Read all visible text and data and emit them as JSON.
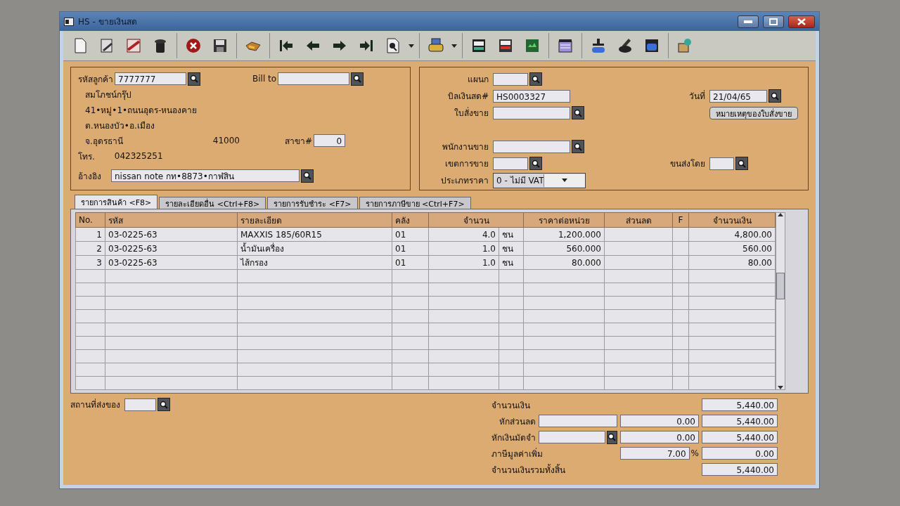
{
  "window": {
    "title": "HS - ขายเงินสด"
  },
  "customer": {
    "code_label": "รหัสลูกค้า",
    "code": "7777777",
    "bill_to_label": "Bill to",
    "name": "สมโภชน์กรุ๊ป",
    "address_lines": [
      "41•หมู่•1•ถนนอุดร-หนองคาย",
      "ต.หนองบัว•อ.เมือง"
    ],
    "province": "จ.อุดรธานี",
    "postcode": "41000",
    "branch_label": "สาขา#",
    "branch": "0",
    "phone_label": "โทร.",
    "phone": "042325251",
    "reference_label": "อ้างอิง",
    "reference": "nissan note กท•8873•กาฬสิน"
  },
  "document": {
    "department_label": "แผนก",
    "bill_label": "บิลเงินสด#",
    "bill_no": "HS0003327",
    "date_label": "วันที่",
    "date": "21/04/65",
    "sales_order_label": "ใบสั่งขาย",
    "note_button": "หมายเหตุของใบสั่งขาย",
    "salesperson_label": "พนักงานขาย",
    "sales_area_label": "เขตการขาย",
    "shipping_label": "ขนส่งโดย",
    "price_type_label": "ประเภทราคา",
    "price_type": "0 - ไม่มี VAT"
  },
  "tabs": [
    {
      "label": "รายการสินค้า <F8>",
      "selected": true
    },
    {
      "label": "รายละเอียดอื่น <Ctrl+F8>",
      "selected": false
    },
    {
      "label": "รายการรับชำระ <F7>",
      "selected": false
    },
    {
      "label": "รายการภาษีขาย <Ctrl+F7>",
      "selected": false
    }
  ],
  "table": {
    "columns": [
      "No.",
      "รหัส",
      "รายละเอียด",
      "คลัง",
      "จำนวน",
      "ราคาต่อหน่วย",
      "ส่วนลด",
      "F",
      "จำนวนเงิน"
    ],
    "rows": [
      {
        "no": "1",
        "code": "03-0225-63",
        "description": "MAXXIS 185/60R15",
        "warehouse": "01",
        "qty": "4.0",
        "unit": "ชน",
        "price": "1,200.000",
        "amount": "4,800.00"
      },
      {
        "no": "2",
        "code": "03-0225-63",
        "description": "น้ำมันเครื่อง",
        "warehouse": "01",
        "qty": "1.0",
        "unit": "ชน",
        "price": "560.000",
        "amount": "560.00"
      },
      {
        "no": "3",
        "code": "03-0225-63",
        "description": "ไส้กรอง",
        "warehouse": "01",
        "qty": "1.0",
        "unit": "ชน",
        "price": "80.000",
        "amount": "80.00"
      }
    ]
  },
  "delivery_label": "สถานที่ส่งของ",
  "summary": [
    {
      "kind": "total",
      "label": "จำนวนเงิน",
      "result": "5,440.00"
    },
    {
      "kind": "discount",
      "label": "หักส่วนลด",
      "value": "0.00",
      "result": "5,440.00"
    },
    {
      "kind": "deposit",
      "label": "หักเงินมัดจำ",
      "value": "0.00",
      "result": "5,440.00"
    },
    {
      "kind": "vat",
      "label": "ภาษีมูลค่าเพิ่ม",
      "value": "7.00",
      "unit": "%",
      "result": "0.00"
    },
    {
      "kind": "grand",
      "label": "จำนวนเงินรวมทั้งสิ้น",
      "result": "5,440.00"
    }
  ]
}
